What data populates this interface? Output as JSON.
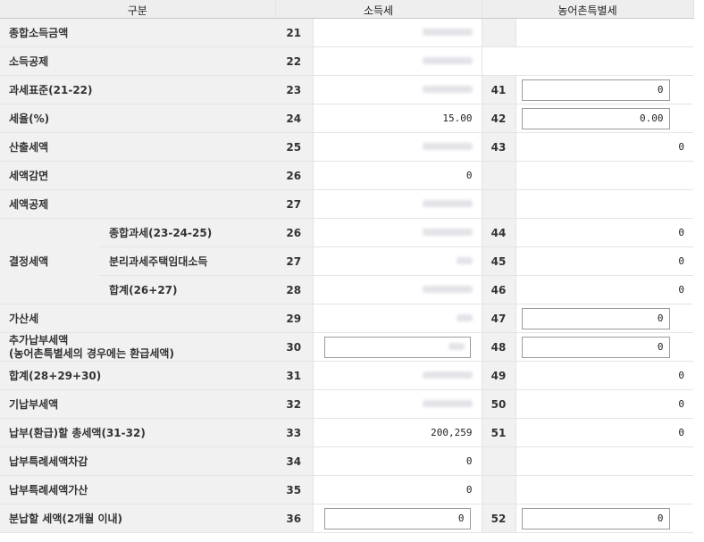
{
  "header": {
    "col_label": "구분",
    "col_income": "소득세",
    "col_rural": "농어촌특별세"
  },
  "rows": {
    "r1": {
      "label": "종합소득금액",
      "no": "21"
    },
    "r2": {
      "label": "소득공제",
      "no": "22"
    },
    "r3": {
      "label": "과세표준(21-22)",
      "no": "23",
      "rno": "41",
      "rval": "0"
    },
    "r4": {
      "label": "세율(%)",
      "no": "24",
      "val": "15.00",
      "rno": "42",
      "rval": "0.00"
    },
    "r5": {
      "label": "산출세액",
      "no": "25",
      "rno": "43",
      "rval": "0"
    },
    "r6": {
      "label": "세액감면",
      "no": "26",
      "val": "0"
    },
    "r7": {
      "label": "세액공제",
      "no": "27"
    },
    "r8": {
      "group": "결정세액",
      "label": "종합과세(23-24-25)",
      "no": "26",
      "rno": "44",
      "rval": "0"
    },
    "r9": {
      "label": "분리과세주택임대소득",
      "no": "27",
      "rno": "45",
      "rval": "0"
    },
    "r10": {
      "label": "합계(26+27)",
      "no": "28",
      "rno": "46",
      "rval": "0"
    },
    "r11": {
      "label": "가산세",
      "no": "29",
      "rno": "47",
      "rval": "0"
    },
    "r12": {
      "label1": "추가납부세액",
      "label2": "(농어촌특별세의 경우에는 환급세액)",
      "no": "30",
      "rno": "48",
      "rval": "0"
    },
    "r13": {
      "label": "합계(28+29+30)",
      "no": "31",
      "rno": "49",
      "rval": "0"
    },
    "r14": {
      "label": "기납부세액",
      "no": "32",
      "rno": "50",
      "rval": "0"
    },
    "r15": {
      "label": "납부(환급)할 총세액(31-32)",
      "no": "33",
      "val": "200,259",
      "rno": "51",
      "rval": "0"
    },
    "r16": {
      "label": "납부특례세액차감",
      "no": "34",
      "val": "0"
    },
    "r17": {
      "label": "납부특례세액가산",
      "no": "35",
      "val": "0"
    },
    "r18": {
      "label": "분납할 세액(2개월 이내)",
      "no": "36",
      "val": "0",
      "rno": "52",
      "rval": "0"
    }
  }
}
